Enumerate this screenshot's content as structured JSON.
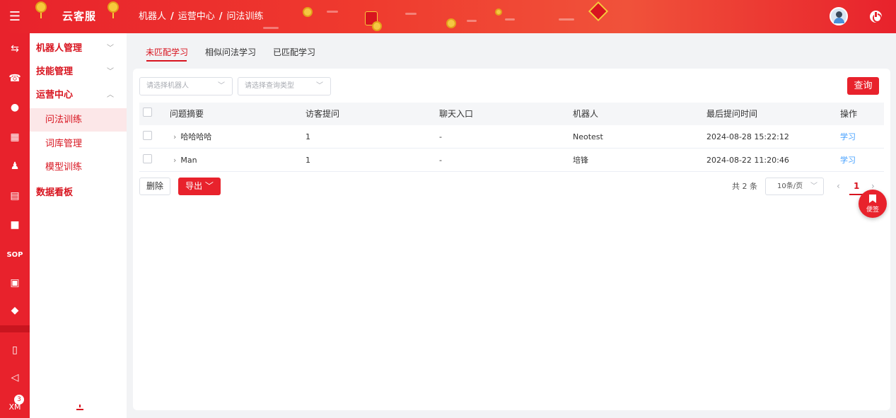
{
  "header": {
    "brand": "云客服",
    "breadcrumb": [
      "机器人",
      "运营中心",
      "问法训练"
    ]
  },
  "rail": {
    "items": [
      "swap-icon",
      "phone-icon",
      "chat-icon",
      "grid-icon",
      "user-icon",
      "clipboard-icon",
      "video-icon",
      "SOP",
      "monitor-icon",
      "shield-icon",
      "book-icon",
      "megaphone-icon",
      "XM"
    ],
    "badge_count": "3"
  },
  "subnav": {
    "groups": [
      {
        "label": "机器人管理",
        "chevron": "﹀"
      },
      {
        "label": "技能管理",
        "chevron": "﹀"
      },
      {
        "label": "运营中心",
        "chevron": "︿"
      }
    ],
    "items": [
      "问法训练",
      "词库管理",
      "模型训练"
    ],
    "extra_group": "数据看板"
  },
  "tabs": [
    "未匹配学习",
    "相似问法学习",
    "已匹配学习"
  ],
  "filters": {
    "robot_placeholder": "请选择机器人",
    "query_type_placeholder": "请选择查询类型",
    "query_button": "查询"
  },
  "table": {
    "columns": [
      "问题摘要",
      "访客提问",
      "聊天入口",
      "机器人",
      "最后提问时间",
      "操作"
    ],
    "rows": [
      {
        "summary": "哈哈哈哈",
        "visitor_questions": "1",
        "entry": "-",
        "robot": "Neotest",
        "last_time": "2024-08-28 15:22:12",
        "action": "学习"
      },
      {
        "summary": "Man",
        "visitor_questions": "1",
        "entry": "-",
        "robot": "培锋",
        "last_time": "2024-08-22 11:20:46",
        "action": "学习"
      }
    ]
  },
  "footer": {
    "delete": "删除",
    "export": "导出",
    "total": "共 2 条",
    "page_size": "10条/页",
    "current_page": "1"
  },
  "note_button": "便签",
  "colors": {
    "accent": "#e8222c",
    "link": "#409eff",
    "active_bg": "#fce7e8"
  }
}
